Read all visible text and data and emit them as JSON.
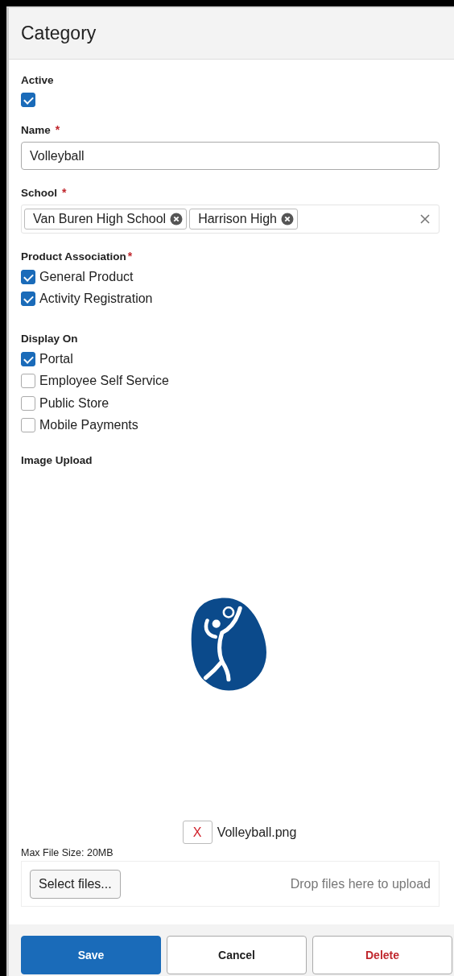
{
  "header": {
    "title": "Category"
  },
  "active": {
    "label": "Active",
    "checked": true
  },
  "name_field": {
    "label": "Name",
    "required_mark": "*",
    "value": "Volleyball"
  },
  "school_field": {
    "label": "School",
    "required_mark": "*",
    "tags": [
      {
        "label": "Van Buren High School"
      },
      {
        "label": "Harrison High"
      }
    ]
  },
  "product_association": {
    "label": "Product Association",
    "required_mark": "*",
    "options": [
      {
        "label": "General Product",
        "checked": true
      },
      {
        "label": "Activity Registration",
        "checked": true
      }
    ]
  },
  "display_on": {
    "label": "Display On",
    "options": [
      {
        "label": "Portal",
        "checked": true
      },
      {
        "label": "Employee Self Service",
        "checked": false
      },
      {
        "label": "Public Store",
        "checked": false
      },
      {
        "label": "Mobile Payments",
        "checked": false
      }
    ]
  },
  "image_upload": {
    "label": "Image Upload",
    "remove_button": "X",
    "file_name": "Volleyball.png",
    "max_size": "Max File Size: 20MB",
    "select_button": "Select files...",
    "drop_hint": "Drop files here to upload"
  },
  "buttons": [
    {
      "label": "Save",
      "kind": "primary"
    },
    {
      "label": "Cancel",
      "kind": "plain"
    },
    {
      "label": "Delete",
      "kind": "danger"
    }
  ]
}
